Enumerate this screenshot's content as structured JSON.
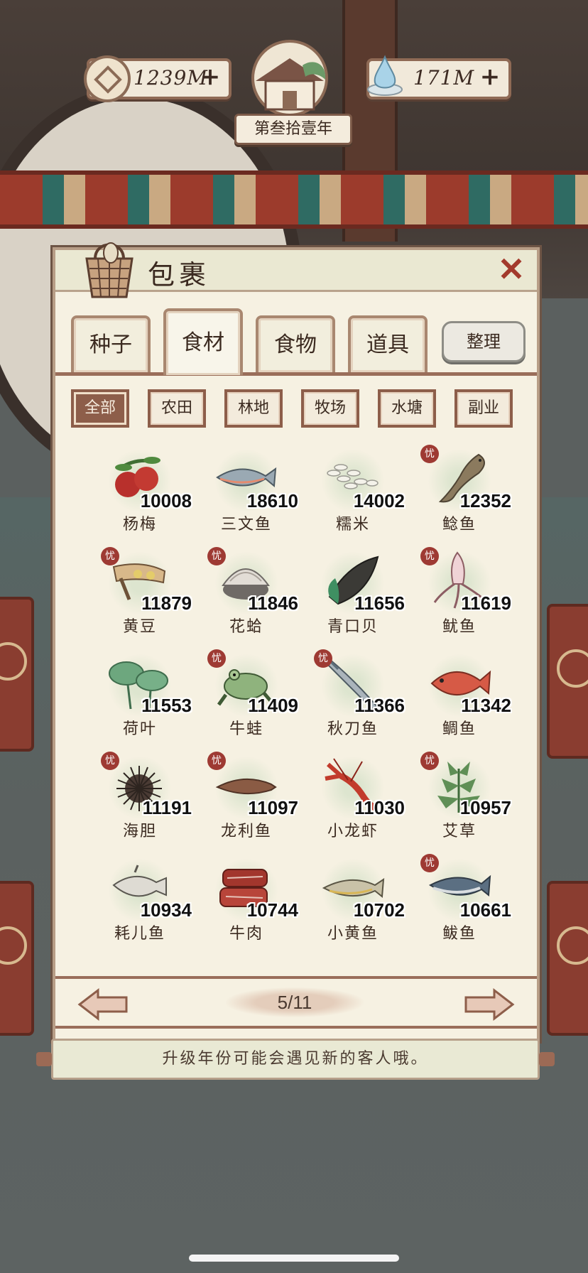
{
  "hud": {
    "coins": "1239M",
    "water": "171M",
    "plus": "+",
    "year": "第叁拾壹年"
  },
  "panel": {
    "title": "包裹",
    "close": "✕"
  },
  "tabs": [
    {
      "label": "种子",
      "active": false
    },
    {
      "label": "食材",
      "active": true
    },
    {
      "label": "食物",
      "active": false
    },
    {
      "label": "道具",
      "active": false
    }
  ],
  "tidy_label": "整理",
  "filters": [
    {
      "label": "全部",
      "active": true
    },
    {
      "label": "农田",
      "active": false
    },
    {
      "label": "林地",
      "active": false
    },
    {
      "label": "牧场",
      "active": false
    },
    {
      "label": "水塘",
      "active": false
    },
    {
      "label": "副业",
      "active": false
    }
  ],
  "badge_text": "忧",
  "items": [
    {
      "name": "杨梅",
      "count": "10008",
      "icon": "bayberry-icon",
      "badge": false
    },
    {
      "name": "三文鱼",
      "count": "18610",
      "icon": "salmon-icon",
      "badge": false
    },
    {
      "name": "糯米",
      "count": "14002",
      "icon": "rice-icon",
      "badge": false
    },
    {
      "name": "鲶鱼",
      "count": "12352",
      "icon": "catfish-icon",
      "badge": true
    },
    {
      "name": "黄豆",
      "count": "11879",
      "icon": "soybean-icon",
      "badge": true
    },
    {
      "name": "花蛤",
      "count": "11846",
      "icon": "clam-icon",
      "badge": true
    },
    {
      "name": "青口贝",
      "count": "11656",
      "icon": "mussel-icon",
      "badge": false
    },
    {
      "name": "鱿鱼",
      "count": "11619",
      "icon": "squid-icon",
      "badge": true
    },
    {
      "name": "荷叶",
      "count": "11553",
      "icon": "lotus-leaf-icon",
      "badge": false
    },
    {
      "name": "牛蛙",
      "count": "11409",
      "icon": "bullfrog-icon",
      "badge": true
    },
    {
      "name": "秋刀鱼",
      "count": "11366",
      "icon": "saury-icon",
      "badge": true
    },
    {
      "name": "鲷鱼",
      "count": "11342",
      "icon": "snapper-icon",
      "badge": false
    },
    {
      "name": "海胆",
      "count": "11191",
      "icon": "sea-urchin-icon",
      "badge": true
    },
    {
      "name": "龙利鱼",
      "count": "11097",
      "icon": "sole-fish-icon",
      "badge": true
    },
    {
      "name": "小龙虾",
      "count": "11030",
      "icon": "crayfish-icon",
      "badge": false
    },
    {
      "name": "艾草",
      "count": "10957",
      "icon": "mugwort-icon",
      "badge": true
    },
    {
      "name": "耗儿鱼",
      "count": "10934",
      "icon": "filefish-icon",
      "badge": false
    },
    {
      "name": "牛肉",
      "count": "10744",
      "icon": "beef-icon",
      "badge": false
    },
    {
      "name": "小黄鱼",
      "count": "10702",
      "icon": "yellow-croaker-icon",
      "badge": false
    },
    {
      "name": "鲅鱼",
      "count": "10661",
      "icon": "mackerel-icon",
      "badge": true
    }
  ],
  "pagination": {
    "label": "5/11",
    "current": 5,
    "total": 11
  },
  "hint": "升级年份可能会遇见新的客人哦。",
  "colors": {
    "accent": "#8d5e4a",
    "badge": "#9e3a33",
    "close": "#a33a2c",
    "panel": "#f6f1e2"
  }
}
